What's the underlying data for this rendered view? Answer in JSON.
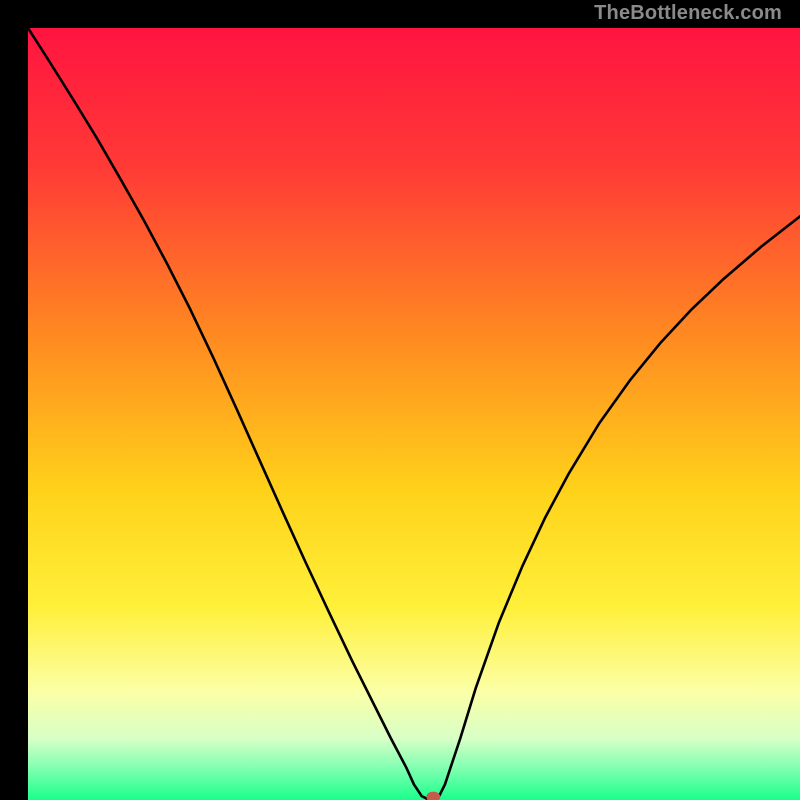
{
  "watermark": "TheBottleneck.com",
  "chart_data": {
    "type": "line",
    "title": "",
    "xlabel": "",
    "ylabel": "",
    "xlim": [
      0,
      100
    ],
    "ylim": [
      0,
      100
    ],
    "grid": false,
    "legend": false,
    "background": {
      "kind": "vertical-gradient",
      "stops": [
        {
          "pos": 0.0,
          "color": "#ff1440"
        },
        {
          "pos": 0.18,
          "color": "#ff3a36"
        },
        {
          "pos": 0.4,
          "color": "#ff8a21"
        },
        {
          "pos": 0.6,
          "color": "#ffd21a"
        },
        {
          "pos": 0.75,
          "color": "#fff03a"
        },
        {
          "pos": 0.86,
          "color": "#fbffa6"
        },
        {
          "pos": 0.92,
          "color": "#d8ffc6"
        },
        {
          "pos": 0.96,
          "color": "#7dffb0"
        },
        {
          "pos": 1.0,
          "color": "#1aff8c"
        }
      ]
    },
    "series": [
      {
        "name": "bottleneck-curve",
        "stroke": "#000000",
        "stroke_width": 2.6,
        "x": [
          0.0,
          3.0,
          6.0,
          9.0,
          12.0,
          15.0,
          18.0,
          21.0,
          24.0,
          27.0,
          30.0,
          33.0,
          36.0,
          39.0,
          42.0,
          45.0,
          47.0,
          49.0,
          50.0,
          51.0,
          52.0,
          53.0,
          54.0,
          56.0,
          58.0,
          61.0,
          64.0,
          67.0,
          70.0,
          74.0,
          78.0,
          82.0,
          86.0,
          90.0,
          95.0,
          100.0
        ],
        "y": [
          100.0,
          95.3,
          90.5,
          85.6,
          80.4,
          75.1,
          69.5,
          63.6,
          57.3,
          50.7,
          44.0,
          37.3,
          30.7,
          24.3,
          18.0,
          12.0,
          8.0,
          4.2,
          2.0,
          0.5,
          0.0,
          0.0,
          2.0,
          8.0,
          14.5,
          23.0,
          30.2,
          36.6,
          42.2,
          48.8,
          54.4,
          59.3,
          63.6,
          67.4,
          71.7,
          75.6
        ]
      }
    ],
    "marker": {
      "name": "optimal-point",
      "x": 52.5,
      "y": 0.0,
      "rx": 0.9,
      "ry": 0.7,
      "fill": "#c65b4d"
    }
  }
}
